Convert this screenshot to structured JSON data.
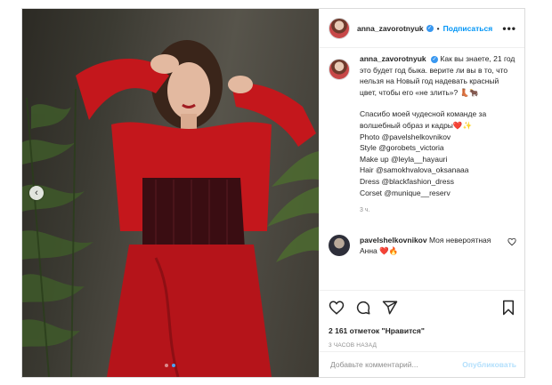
{
  "post": {
    "username": "anna_zavorotnyuk",
    "follow_label": "Подписаться",
    "bullet": "•",
    "more_label": "•••",
    "caption": {
      "line1": "Как вы знаете, 21 год это будет год быка. верите ли вы в то, что нельзя на Новый год надевать красный цвет, чтобы его «не злить»? 👢🐂",
      "line2": "Спасибо моей чудесной команде за волшебный образ и кадры❤️✨",
      "credits": [
        "Photo @pavelshelkovnikov",
        "Style @gorobets_victoria",
        "Make up @leyla__hayauri",
        "Hair @samokhvalova_oksanaaa",
        "Dress @blackfashion_dress",
        "Corset @munique__reserv"
      ],
      "time": "3 ч."
    },
    "comment": {
      "username": "pavelshelkovnikov",
      "text": "Моя невероятная Анна ❤️🔥"
    },
    "likes": "2 161 отметок \"Нравится\"",
    "ago": "3 ЧАСОВ НАЗАД",
    "comment_input": {
      "placeholder": "Добавьте комментарий..."
    },
    "publish_label": "Опубликовать",
    "carousel": {
      "count": 2,
      "current": 2
    }
  },
  "icons": {
    "heart": "heart-icon",
    "comment": "comment-icon",
    "share": "share-icon",
    "bookmark": "bookmark-icon",
    "verified": "verified-badge-icon",
    "prev": "chevron-left-icon"
  },
  "colors": {
    "accent": "#0095f6",
    "publish_disabled": "#b2dffc",
    "dress_red": "#c4171c"
  }
}
